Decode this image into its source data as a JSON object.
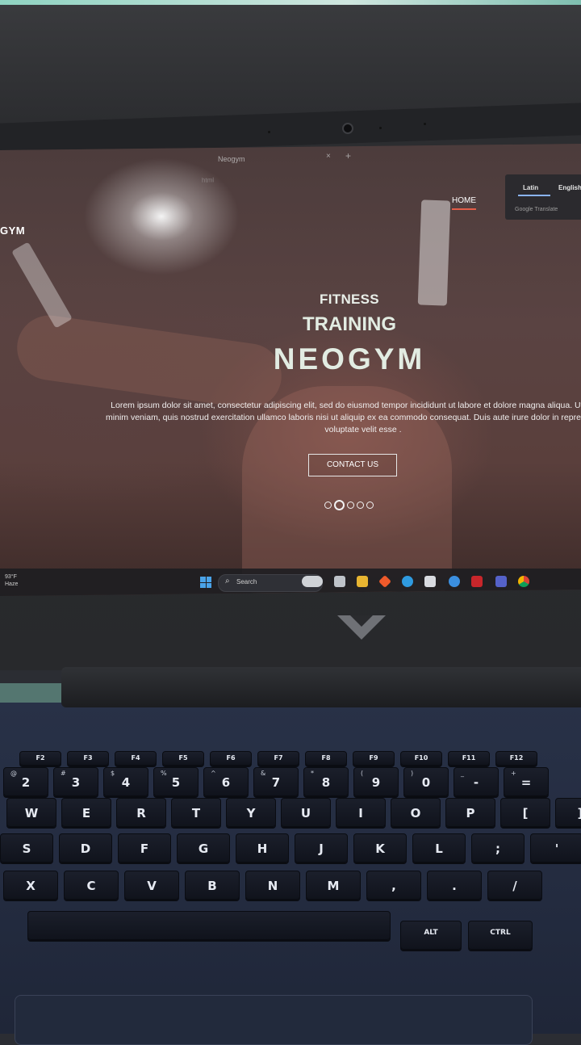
{
  "browser": {
    "tab_title": "Neogym",
    "close_glyph": "×",
    "new_tab_glyph": "+",
    "address_fragment": "html"
  },
  "translate_popup": {
    "lang_a": "Latin",
    "lang_b": "English",
    "footer": "Google Translate"
  },
  "site": {
    "logo": "GYM",
    "nav_home": "HOME",
    "hero": {
      "line1": "FITNESS",
      "line2": "TRAINING",
      "line3": "NEOGYM",
      "body": "Lorem ipsum dolor sit amet, consectetur adipiscing elit, sed do eiusmod tempor incididunt ut labore et dolore magna aliqua. Ut enim ad minim veniam, quis nostrud exercitation ullamco laboris nisi ut aliquip ex ea commodo consequat. Duis aute irure dolor in reprehenderit in voluptate velit esse .",
      "cta": "CONTACT US"
    },
    "slider": {
      "count": 5,
      "active_index": 1
    }
  },
  "taskbar": {
    "weather_temp": "93°F",
    "weather_desc": "Haze",
    "search_placeholder": "Search",
    "icons": [
      "start-icon",
      "copilot-icon",
      "task-view-icon",
      "file-explorer-icon",
      "store-diamond-icon",
      "edge-icon",
      "store-icon",
      "help-icon",
      "mcafee-icon",
      "teams-icon",
      "chrome-icon"
    ]
  },
  "keyboard": {
    "function_row": [
      "F2",
      "F3",
      "F4",
      "F5",
      "F6",
      "F7",
      "F8",
      "F9",
      "F10",
      "F11",
      "F12"
    ],
    "number_row": [
      {
        "main": "2",
        "sub": "@"
      },
      {
        "main": "3",
        "sub": "#"
      },
      {
        "main": "4",
        "sub": "$"
      },
      {
        "main": "5",
        "sub": "%"
      },
      {
        "main": "6",
        "sub": "^"
      },
      {
        "main": "7",
        "sub": "&"
      },
      {
        "main": "8",
        "sub": "*"
      },
      {
        "main": "9",
        "sub": "("
      },
      {
        "main": "0",
        "sub": ")"
      },
      {
        "main": "-",
        "sub": "_"
      },
      {
        "main": "=",
        "sub": "+"
      }
    ],
    "row_q": [
      "W",
      "E",
      "R",
      "T",
      "Y",
      "U",
      "I",
      "O",
      "P",
      "[",
      "]"
    ],
    "row_a": [
      "S",
      "D",
      "F",
      "G",
      "H",
      "J",
      "K",
      "L",
      ";",
      "'"
    ],
    "row_z": [
      "X",
      "C",
      "V",
      "B",
      "N",
      "M",
      ",",
      ".",
      "/"
    ],
    "alt_label": "ALT",
    "ctrl_label": "CTRL"
  }
}
